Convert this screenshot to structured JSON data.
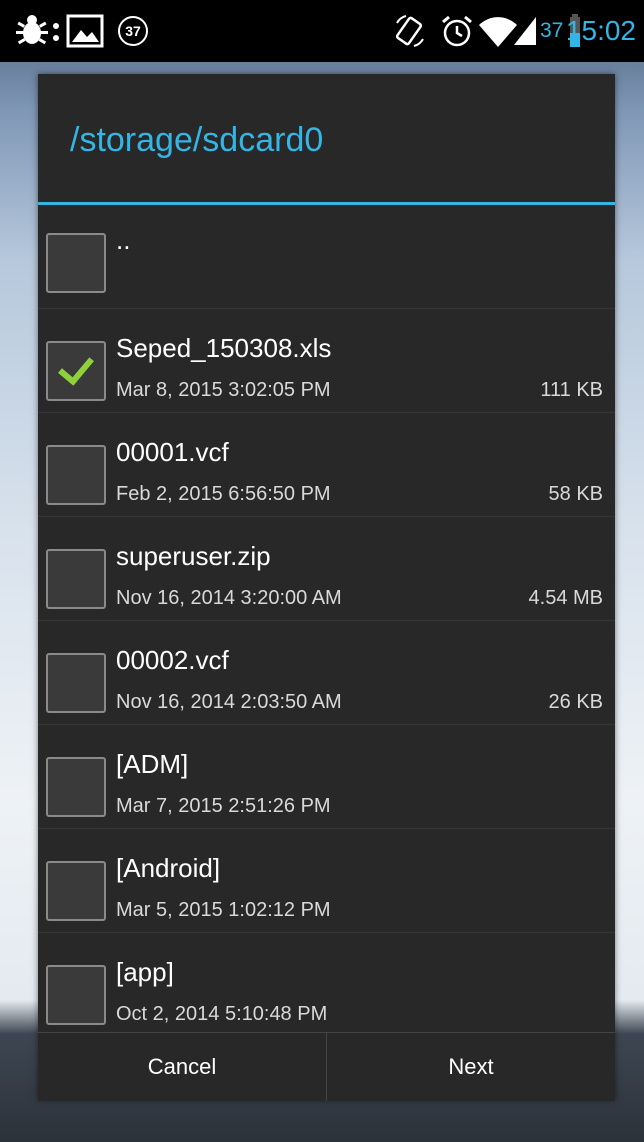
{
  "status_bar": {
    "notification_count": "37",
    "battery_level": "37",
    "time": "15:02",
    "icons": [
      "usb-debug-icon",
      "image-notification-icon",
      "rotate-icon",
      "alarm-icon",
      "wifi-icon",
      "signal-icon",
      "battery-icon"
    ]
  },
  "dialog": {
    "title": "/storage/sdcard0",
    "accent_color": "#33b5e5",
    "items": [
      {
        "name": "..",
        "date": "",
        "size": "",
        "checked": false
      },
      {
        "name": "Seped_150308.xls",
        "date": "Mar 8, 2015 3:02:05 PM",
        "size": "111 KB",
        "checked": true
      },
      {
        "name": "00001.vcf",
        "date": "Feb 2, 2015 6:56:50 PM",
        "size": "58 KB",
        "checked": false
      },
      {
        "name": "superuser.zip",
        "date": "Nov 16, 2014 3:20:00 AM",
        "size": "4.54 MB",
        "checked": false
      },
      {
        "name": "00002.vcf",
        "date": "Nov 16, 2014 2:03:50 AM",
        "size": "26 KB",
        "checked": false
      },
      {
        "name": "[ADM]",
        "date": "Mar 7, 2015 2:51:26 PM",
        "size": "",
        "checked": false
      },
      {
        "name": "[Android]",
        "date": "Mar 5, 2015 1:02:12 PM",
        "size": "",
        "checked": false
      },
      {
        "name": "[app]",
        "date": "Oct 2, 2014 5:10:48 PM",
        "size": "",
        "checked": false
      }
    ],
    "buttons": {
      "cancel": "Cancel",
      "next": "Next"
    }
  }
}
